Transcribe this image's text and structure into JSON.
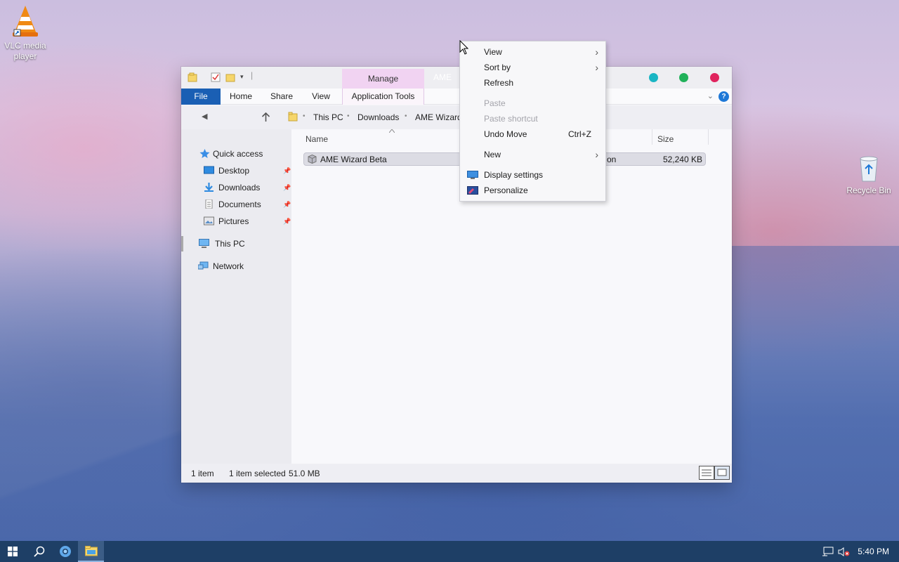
{
  "desktop": {
    "icons": [
      {
        "label": "VLC media player"
      },
      {
        "label": "Recycle Bin"
      }
    ]
  },
  "window": {
    "manage_tab": "Manage",
    "title_partial": "AME",
    "colors": {
      "dot1": "#1ab5c4",
      "dot2": "#21b15a",
      "dot3": "#e0245e",
      "file_tab": "#1a5fb4",
      "manage_tab": "#f1d3f2"
    },
    "ribbon": {
      "file": "File",
      "home": "Home",
      "share": "Share",
      "view": "View",
      "app_tools": "Application Tools"
    },
    "address": {
      "this_pc": "This PC",
      "downloads": "Downloads",
      "ame_wizard": "AME Wizard"
    },
    "nav": {
      "quick_access": "Quick access",
      "desktop": "Desktop",
      "downloads": "Downloads",
      "documents": "Documents",
      "pictures": "Pictures",
      "this_pc": "This PC",
      "network": "Network"
    },
    "columns": {
      "name": "Name",
      "size": "Size"
    },
    "files": [
      {
        "name": "AME Wizard Beta",
        "type_partial": "on",
        "size": "52,240 KB"
      }
    ],
    "status": {
      "items": "1 item",
      "selected": "1 item selected",
      "size": "51.0 MB"
    }
  },
  "context_menu": {
    "view": "View",
    "sort_by": "Sort by",
    "refresh": "Refresh",
    "paste": "Paste",
    "paste_shortcut": "Paste shortcut",
    "undo_move": "Undo Move",
    "undo_shortcut": "Ctrl+Z",
    "new": "New",
    "display_settings": "Display settings",
    "personalize": "Personalize"
  },
  "taskbar": {
    "time": "5:40 PM"
  }
}
